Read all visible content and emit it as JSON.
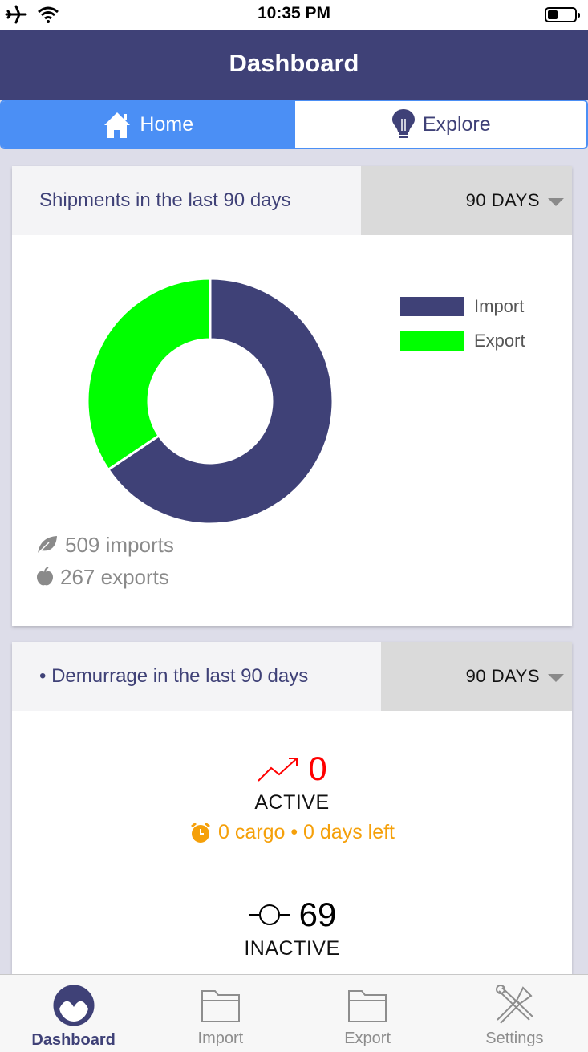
{
  "status_bar": {
    "time": "10:35 PM"
  },
  "header": {
    "title": "Dashboard"
  },
  "tabs": [
    {
      "label": "Home",
      "icon": "home-icon",
      "active": true
    },
    {
      "label": "Explore",
      "icon": "lightbulb-icon",
      "active": false
    }
  ],
  "shipments_card": {
    "title": "Shipments in the last 90 days",
    "period": "90 DAYS",
    "legend": [
      {
        "label": "Import",
        "color": "#3f4177"
      },
      {
        "label": "Export",
        "color": "#00ff00"
      }
    ],
    "imports_text": "509 imports",
    "exports_text": "267 exports"
  },
  "chart_data": {
    "type": "pie",
    "categories": [
      "Import",
      "Export"
    ],
    "values": [
      509,
      267
    ],
    "colors": [
      "#3f4177",
      "#00ff00"
    ],
    "donut": true,
    "legend_position": "top-right"
  },
  "demurrage_card": {
    "title": "• Demurrage in the last 90 days",
    "period": "90 DAYS",
    "active": {
      "count": "0",
      "label": "ACTIVE",
      "color": "#ff0000"
    },
    "cargo_text": "0 cargo • 0 days left",
    "inactive": {
      "count": "69",
      "label": "INACTIVE"
    }
  },
  "tabbar": [
    {
      "label": "Dashboard",
      "icon": "dashboard-icon",
      "active": true
    },
    {
      "label": "Import",
      "icon": "folder-icon",
      "active": false
    },
    {
      "label": "Export",
      "icon": "folder-icon",
      "active": false
    },
    {
      "label": "Settings",
      "icon": "tools-icon",
      "active": false
    }
  ],
  "colors": {
    "primary": "#3f4177",
    "accent": "#4b8ff5",
    "warning": "#f5a00a"
  }
}
